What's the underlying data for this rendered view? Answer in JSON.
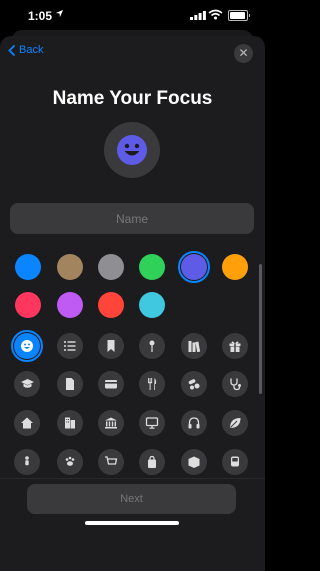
{
  "status_bar": {
    "time": "1:05"
  },
  "nav": {
    "back_label": "Back",
    "close_icon": "close-icon",
    "back_icon": "chevron-left-icon"
  },
  "title": "Name Your Focus",
  "preview": {
    "icon": "smiley-face-icon",
    "color": "#5e5ce6"
  },
  "name_field": {
    "placeholder": "Name",
    "value": ""
  },
  "colors": {
    "swatches": [
      "#0a84ff",
      "#a2845e",
      "#8e8e93",
      "#30d158",
      "#5e5ce6",
      "#ff9f0a",
      "#ff375f",
      "#bf5af2",
      "#ff453a",
      "#40c8e0"
    ],
    "selected": "#5e5ce6"
  },
  "icons": {
    "selected": "smiley-face-icon",
    "rows": [
      [
        "smiley-face-icon",
        "list-icon",
        "bookmark-icon",
        "pin-icon",
        "books-icon",
        "gift-icon"
      ],
      [
        "graduation-cap-icon",
        "document-icon",
        "credit-card-icon",
        "fork-knife-icon",
        "pills-icon",
        "stethoscope-icon"
      ],
      [
        "house-icon",
        "building-icon",
        "bank-icon",
        "monitor-icon",
        "headphones-icon",
        "leaf-icon"
      ],
      [
        "person-icon",
        "paw-icon",
        "cart-icon",
        "bag-icon",
        "box-icon",
        "tram-icon"
      ]
    ]
  },
  "next_label": "Next",
  "accent": "#0a84ff"
}
